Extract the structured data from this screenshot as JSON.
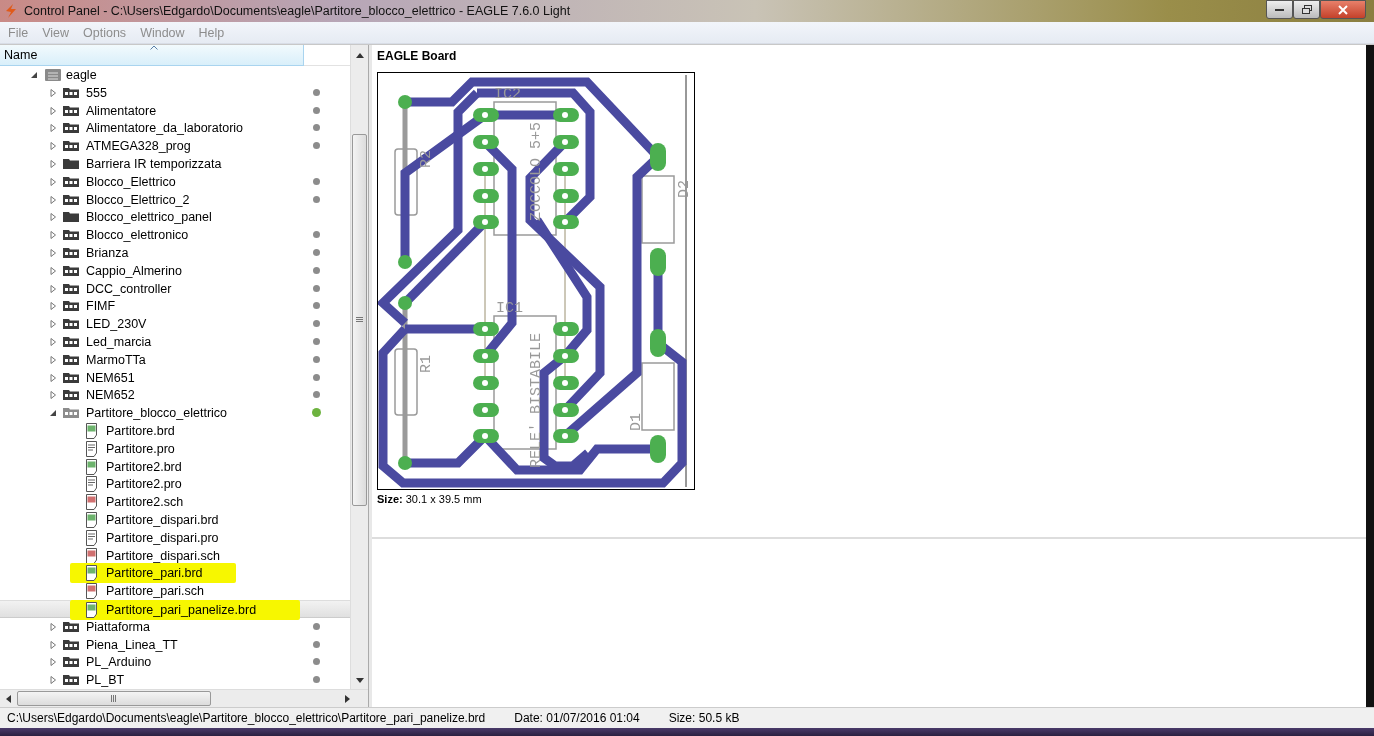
{
  "window": {
    "title": "Control Panel - C:\\Users\\Edgardo\\Documents\\eagle\\Partitore_blocco_elettrico - EAGLE 7.6.0 Light"
  },
  "menu": [
    "File",
    "View",
    "Options",
    "Window",
    "Help"
  ],
  "tree": {
    "header": "Name",
    "root": {
      "label": "eagle",
      "expanded": true,
      "children": [
        {
          "label": "555",
          "kind": "project",
          "expanded": false,
          "open": false
        },
        {
          "label": "Alimentatore",
          "kind": "project",
          "expanded": false,
          "open": false
        },
        {
          "label": "Alimentatore_da_laboratorio",
          "kind": "project",
          "expanded": false,
          "open": false
        },
        {
          "label": "ATMEGA328_prog",
          "kind": "project",
          "expanded": false,
          "open": false
        },
        {
          "label": "Barriera IR temporizzata",
          "kind": "folder",
          "expanded": false
        },
        {
          "label": "Blocco_Elettrico",
          "kind": "project",
          "expanded": false,
          "open": false
        },
        {
          "label": "Blocco_Elettrico_2",
          "kind": "project",
          "expanded": false,
          "open": false
        },
        {
          "label": "Blocco_elettrico_panel",
          "kind": "folder",
          "expanded": false
        },
        {
          "label": "Blocco_elettronico",
          "kind": "project",
          "expanded": false,
          "open": false
        },
        {
          "label": "Brianza",
          "kind": "project",
          "expanded": false,
          "open": false
        },
        {
          "label": "Cappio_Almerino",
          "kind": "project",
          "expanded": false,
          "open": false
        },
        {
          "label": "DCC_controller",
          "kind": "project",
          "expanded": false,
          "open": false
        },
        {
          "label": "FIMF",
          "kind": "project",
          "expanded": false,
          "open": false
        },
        {
          "label": "LED_230V",
          "kind": "project",
          "expanded": false,
          "open": false
        },
        {
          "label": "Led_marcia",
          "kind": "project",
          "expanded": false,
          "open": false
        },
        {
          "label": "MarmoTTa",
          "kind": "project",
          "expanded": false,
          "open": false
        },
        {
          "label": "NEM651",
          "kind": "project",
          "expanded": false,
          "open": false
        },
        {
          "label": "NEM652",
          "kind": "project",
          "expanded": false,
          "open": false
        },
        {
          "label": "Partitore_blocco_elettrico",
          "kind": "project",
          "expanded": true,
          "open": true,
          "children": [
            {
              "label": "Partitore.brd",
              "kind": "board",
              "selected": false,
              "highlighted": false
            },
            {
              "label": "Partitore.pro",
              "kind": "text",
              "selected": false,
              "highlighted": false
            },
            {
              "label": "Partitore2.brd",
              "kind": "board",
              "selected": false,
              "highlighted": false
            },
            {
              "label": "Partitore2.pro",
              "kind": "text",
              "selected": false,
              "highlighted": false
            },
            {
              "label": "Partitore2.sch",
              "kind": "schematic",
              "selected": false,
              "highlighted": false
            },
            {
              "label": "Partitore_dispari.brd",
              "kind": "board",
              "selected": false,
              "highlighted": false
            },
            {
              "label": "Partitore_dispari.pro",
              "kind": "text",
              "selected": false,
              "highlighted": false
            },
            {
              "label": "Partitore_dispari.sch",
              "kind": "schematic",
              "selected": false,
              "highlighted": false
            },
            {
              "label": "Partitore_pari.brd",
              "kind": "board",
              "selected": false,
              "highlighted": true
            },
            {
              "label": "Partitore_pari.sch",
              "kind": "schematic",
              "selected": false,
              "highlighted": false
            },
            {
              "label": "Partitore_pari_panelize.brd",
              "kind": "board",
              "selected": true,
              "highlighted": true
            }
          ]
        },
        {
          "label": "Piattaforma",
          "kind": "project",
          "expanded": false,
          "open": false
        },
        {
          "label": "Piena_Linea_TT",
          "kind": "project",
          "expanded": false,
          "open": false
        },
        {
          "label": "PL_Arduino",
          "kind": "project",
          "expanded": false,
          "open": false
        },
        {
          "label": "PL_BT",
          "kind": "project",
          "expanded": false,
          "open": false
        }
      ]
    }
  },
  "preview": {
    "title": "EAGLE Board",
    "size": "**Size:** 30.1 x 39.5 mm",
    "board_labels": [
      "IC2",
      "ZOCCOLO 5+5",
      "R2",
      "D2",
      "IC1",
      "RELE' BISTABILE",
      "R1",
      "D1"
    ]
  },
  "status_bar": {
    "path": "C:\\Users\\Edgardo\\Documents\\eagle\\Partitore_blocco_elettrico\\Partitore_pari_panelize.brd",
    "date": "Date: 01/07/2016 01:04",
    "size": "Size: 50.5 kB"
  }
}
